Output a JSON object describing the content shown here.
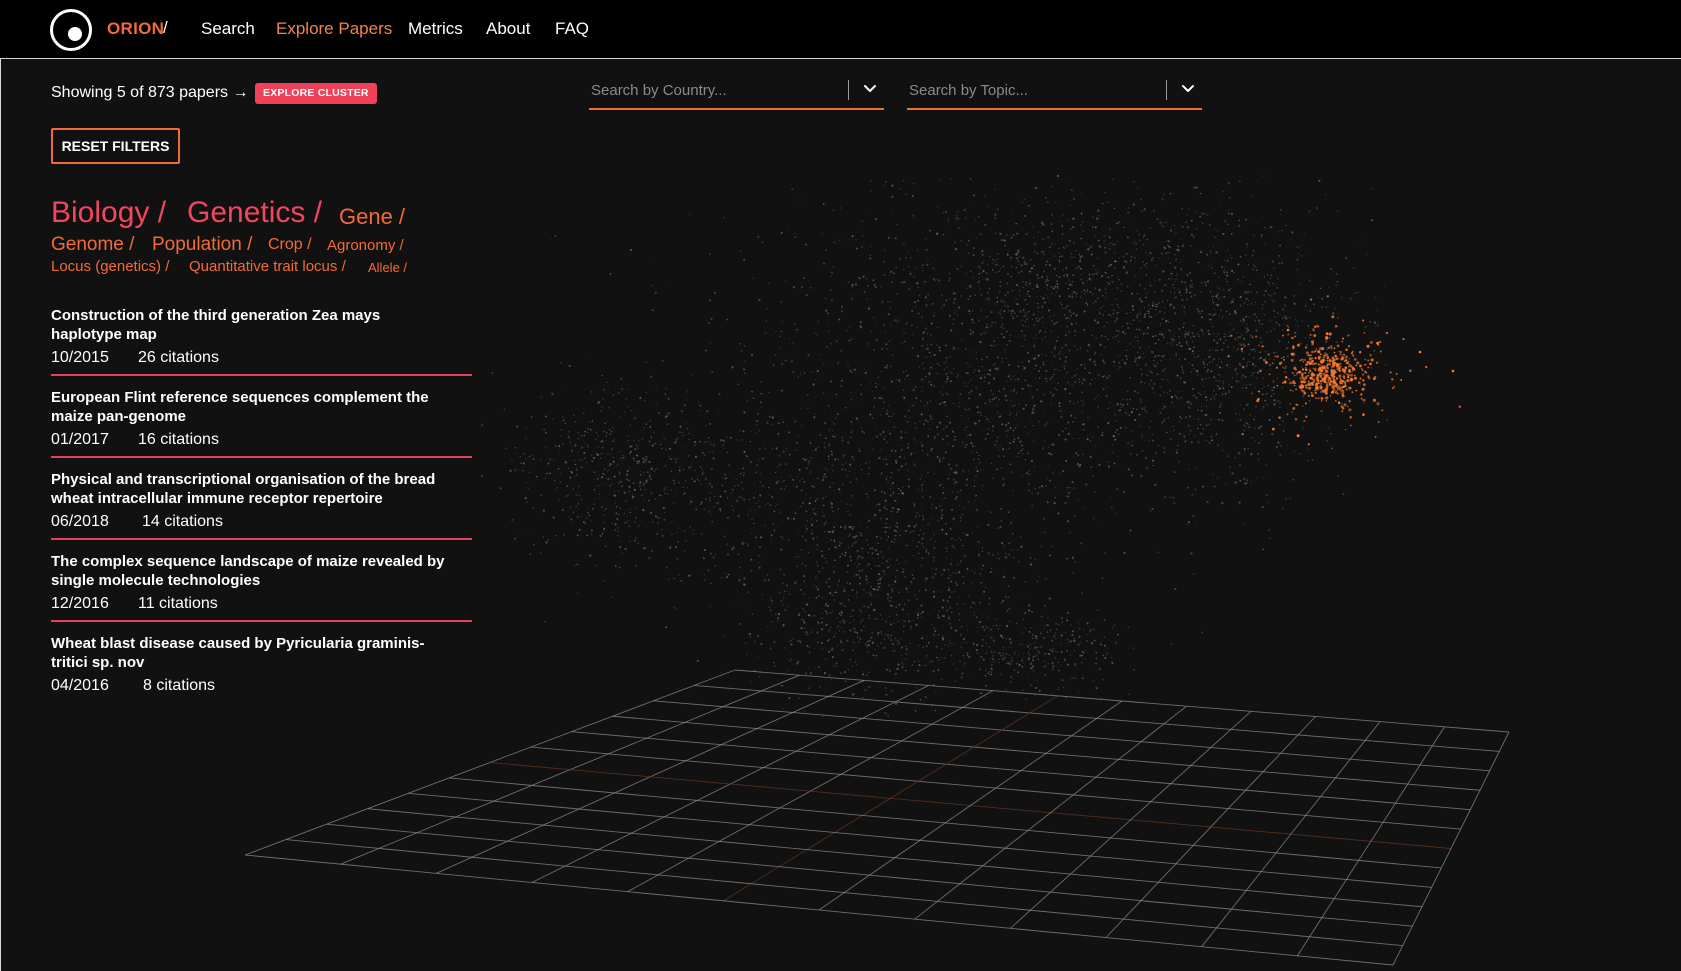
{
  "header": {
    "brand": "ORION",
    "brand_slash": "/",
    "nav": [
      {
        "label": "Search",
        "active": false
      },
      {
        "label": "Explore Papers",
        "active": true
      },
      {
        "label": "Metrics",
        "active": false
      },
      {
        "label": "About",
        "active": false
      },
      {
        "label": "FAQ",
        "active": false
      }
    ]
  },
  "results": {
    "count_text": "Showing 5 of 873 papers →",
    "explore_cluster_label": "EXPLORE CLUSTER",
    "reset_label": "RESET FILTERS"
  },
  "filters": {
    "country_placeholder": "Search by Country...",
    "topic_placeholder": "Search by Topic..."
  },
  "breadcrumb": [
    "Biology /",
    "Genetics /",
    "Gene /",
    "Genome /",
    "Population /",
    "Crop /",
    "Agronomy /",
    "Locus (genetics) /",
    "Quantitative trait locus /",
    "Allele /"
  ],
  "papers": [
    {
      "title_line1": "Construction of the third generation Zea mays",
      "title_line2": "haplotype map",
      "date": "10/2015",
      "citations": "26 citations"
    },
    {
      "title_line1": "European Flint reference sequences complement the",
      "title_line2": "maize pan-genome",
      "date": "01/2017",
      "citations": "16 citations"
    },
    {
      "title_line1": "Physical and transcriptional organisation of the bread",
      "title_line2": "wheat intracellular immune receptor repertoire",
      "date": "06/2018",
      "citations": "14 citations"
    },
    {
      "title_line1": "The complex sequence landscape of maize revealed by",
      "title_line2": "single molecule technologies",
      "date": "12/2016",
      "citations": "11 citations"
    },
    {
      "title_line1": "Wheat blast disease caused by Pyricularia graminis-",
      "title_line2": "tritici sp. nov",
      "date": "04/2016",
      "citations": "8 citations"
    }
  ],
  "colors": {
    "accent_orange": "#f46a38",
    "accent_pink": "#f4455e",
    "background": "#111111",
    "highlight_cluster": "#ff7a2e"
  },
  "icons": {
    "logo": "orion-logo-icon",
    "dropdown": "chevron-down-icon"
  }
}
